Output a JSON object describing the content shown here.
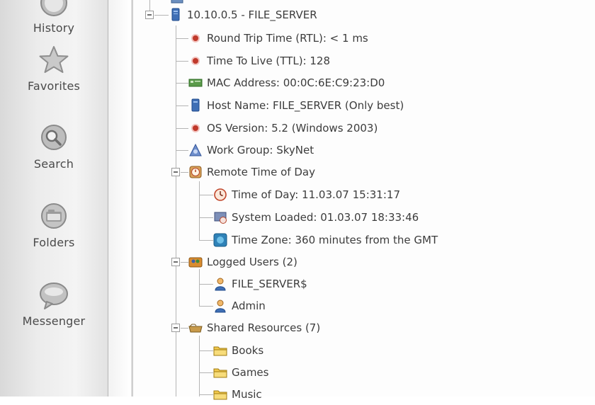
{
  "sidebar": {
    "items": [
      {
        "label": "History",
        "icon": "history-icon"
      },
      {
        "label": "Favorites",
        "icon": "star-icon"
      },
      {
        "label": "Search",
        "icon": "search-icon"
      },
      {
        "label": "Folders",
        "icon": "folders-icon"
      },
      {
        "label": "Messenger",
        "icon": "messenger-icon"
      }
    ]
  },
  "tree": {
    "host": {
      "label": "10.10.0.5 - FILE_SERVER",
      "icon": "computer-icon"
    },
    "properties": [
      {
        "label": "Round Trip Time (RTL): < 1 ms",
        "icon": "red-dot-icon"
      },
      {
        "label": "Time To Live (TTL): 128",
        "icon": "red-dot-icon"
      },
      {
        "label": "MAC Address: 00:0C:6E:C9:23:D0",
        "icon": "network-card-icon"
      },
      {
        "label": "Host Name: FILE_SERVER (Only best)",
        "icon": "computer-icon"
      },
      {
        "label": "OS Version: 5.2 (Windows 2003)",
        "icon": "red-dot-icon"
      },
      {
        "label": "Work Group: SkyNet",
        "icon": "workgroup-icon"
      }
    ],
    "remote_time": {
      "label": "Remote Time of Day",
      "icon": "clock-icon",
      "children": [
        {
          "label": "Time of Day: 11.03.07 15:31:17",
          "icon": "clock-icon"
        },
        {
          "label": "System Loaded: 01.03.07 18:33:46",
          "icon": "system-loaded-icon"
        },
        {
          "label": "Time Zone: 360 minutes from the GMT",
          "icon": "globe-icon"
        }
      ]
    },
    "logged_users": {
      "label": "Logged Users (2)",
      "icon": "users-icon",
      "children": [
        {
          "label": "FILE_SERVER$",
          "icon": "user-icon"
        },
        {
          "label": "Admin",
          "icon": "user-icon"
        }
      ]
    },
    "shared_resources": {
      "label": "Shared Resources (7)",
      "icon": "shared-folder-icon",
      "children": [
        {
          "label": "Books",
          "icon": "folder-icon"
        },
        {
          "label": "Games",
          "icon": "folder-icon"
        },
        {
          "label": "Music",
          "icon": "folder-icon"
        }
      ]
    }
  }
}
